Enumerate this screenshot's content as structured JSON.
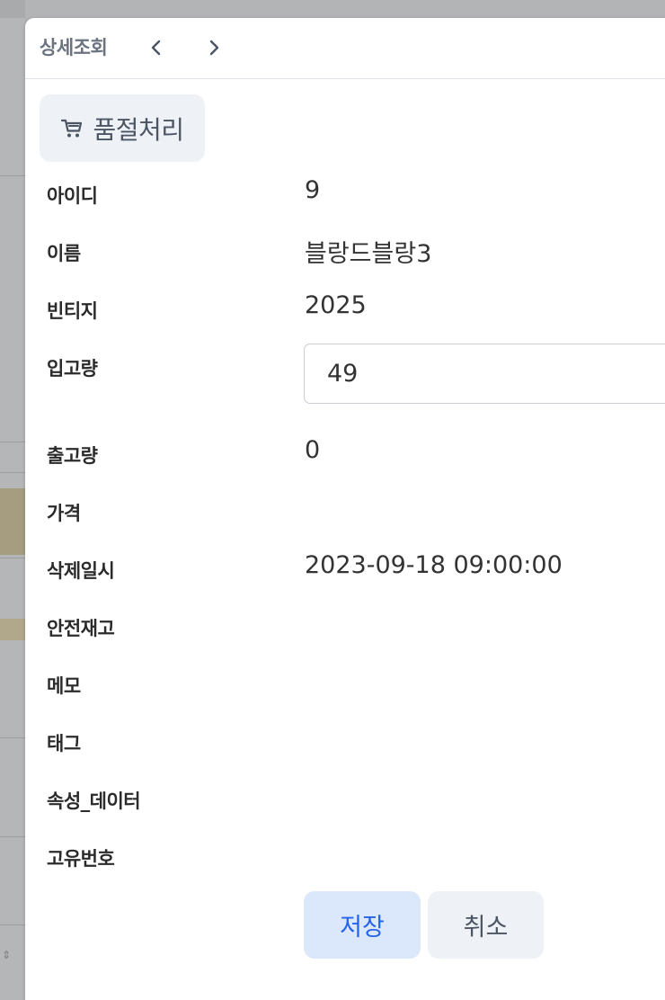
{
  "header": {
    "title": "상세조회",
    "prev_icon": "chevron-left-icon",
    "next_icon": "chevron-right-icon"
  },
  "actions": {
    "soldout_label": "품절처리",
    "soldout_icon": "cart-icon"
  },
  "fields": {
    "id": {
      "label": "아이디",
      "value": "9"
    },
    "name": {
      "label": "이름",
      "value": "블랑드블랑3"
    },
    "vintage": {
      "label": "빈티지",
      "value": "2025"
    },
    "inbound": {
      "label": "입고량",
      "value": "49"
    },
    "outbound": {
      "label": "출고량",
      "value": "0"
    },
    "price": {
      "label": "가격",
      "value": ""
    },
    "deleted_at": {
      "label": "삭제일시",
      "value": "2023-09-18 09:00:00"
    },
    "safety_stock": {
      "label": "안전재고",
      "value": ""
    },
    "memo": {
      "label": "메모",
      "value": ""
    },
    "tags": {
      "label": "태그",
      "value": ""
    },
    "attributes": {
      "label": "속성_데이터",
      "value": ""
    },
    "serial": {
      "label": "고유번호",
      "value": ""
    }
  },
  "footer": {
    "save_label": "저장",
    "cancel_label": "취소"
  },
  "colors": {
    "accent": "#2563eb",
    "save_bg": "#dbe7fa",
    "button_bg": "#eef1f6",
    "label_text": "#2b2b2b",
    "muted_text": "#6b7280"
  }
}
